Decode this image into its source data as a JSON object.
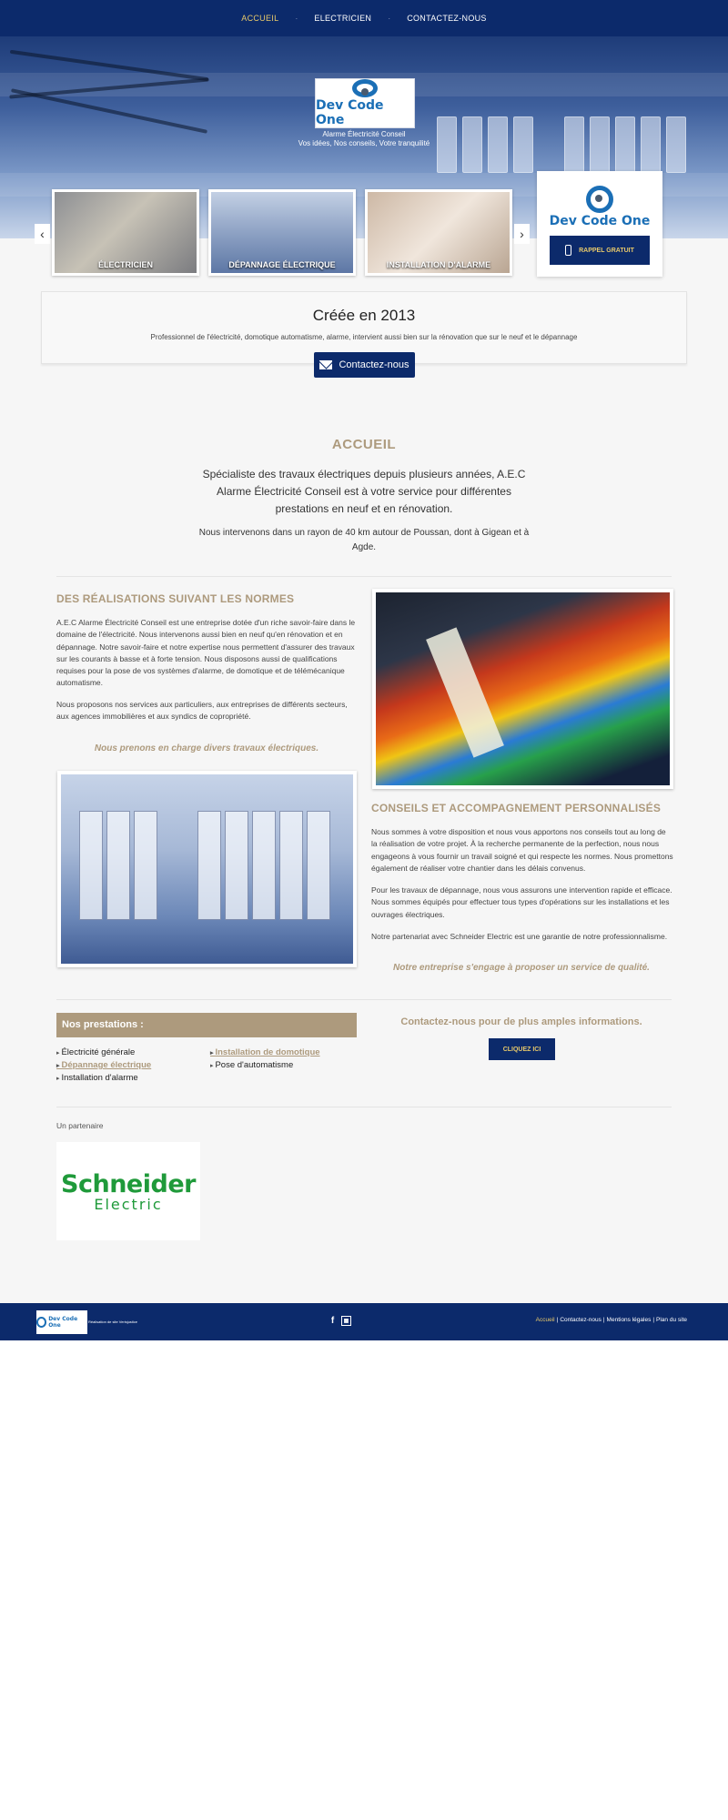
{
  "nav": {
    "items": [
      {
        "label": "ACCUEIL",
        "active": true
      },
      {
        "label": "ELECTRICIEN",
        "active": false
      },
      {
        "label": "CONTACTEZ-NOUS",
        "active": false
      }
    ],
    "separator": "·"
  },
  "hero": {
    "logo_text": "Dev Code One",
    "subtitle_1": "Alarme Électricité Conseil",
    "subtitle_2": "Vos idées, Nos conseils, Votre tranquilité",
    "thumbs": [
      {
        "label": "ÉLECTRICIEN"
      },
      {
        "label": "DÉPANNAGE ÉLECTRIQUE"
      },
      {
        "label": "INSTALLATION D'ALARME"
      }
    ],
    "prev_arrow": "‹",
    "next_arrow": "›"
  },
  "card": {
    "logo_text": "Dev Code One",
    "button_label": "RAPPEL GRATUIT"
  },
  "created": {
    "title": "Créée en 2013",
    "text": "Professionnel de l'électricité, domotique automatisme, alarme, intervient aussi bien sur la rénovation que sur le neuf et le dépannage",
    "button_label": "Contactez-nous"
  },
  "accueil": {
    "title": "ACCUEIL",
    "lead": "Spécialiste des travaux électriques depuis plusieurs années, A.E.C Alarme Électricité Conseil est à votre service pour différentes prestations en neuf et en rénovation.",
    "zone": "Nous intervenons dans un rayon de 40 km autour de Poussan, dont à Gigean et à Agde."
  },
  "realisations": {
    "title": "DES RÉALISATIONS SUIVANT LES NORMES",
    "p1": "A.E.C Alarme Électricité Conseil est une entreprise dotée d'un riche savoir-faire dans le domaine de l'électricité. Nous intervenons aussi bien en neuf qu'en rénovation et en dépannage. Notre savoir-faire et notre expertise nous permettent d'assurer des travaux sur les courants à basse et à forte tension. Nous disposons aussi de qualifications requises pour la pose de vos systèmes d'alarme, de domotique et de télémécanique automatisme.",
    "p2": "Nous proposons nos services aux particuliers, aux entreprises de différents secteurs, aux agences immobilières et aux syndics de copropriété.",
    "quote": "Nous prenons en charge divers travaux électriques."
  },
  "conseils": {
    "title": "CONSEILS ET ACCOMPAGNEMENT PERSONNALISÉS",
    "p1": "Nous sommes à votre disposition et nous vous apportons nos conseils tout au long de la réalisation de votre projet. À la recherche permanente de la perfection, nous nous engageons à vous fournir un travail soigné et qui respecte les normes. Nous promettons également de réaliser votre chantier dans les délais convenus.",
    "p2": "Pour les travaux de dépannage, nous vous assurons une intervention rapide et efficace. Nous sommes équipés pour effectuer tous types d'opérations sur les installations et les ouvrages électriques.",
    "p3": "Notre partenariat avec Schneider Electric est une garantie de notre professionnalisme.",
    "quote": "Notre entreprise s'engage à proposer un service de qualité."
  },
  "prestations": {
    "title": "Nos prestations :",
    "col1": [
      {
        "label": "Électricité générale",
        "link": false
      },
      {
        "label": "Dépannage électrique",
        "link": true
      },
      {
        "label": "Installation d'alarme",
        "link": false
      }
    ],
    "col2": [
      {
        "label": "Installation de domotique",
        "link": true
      },
      {
        "label": "Pose d'automatisme",
        "link": false
      }
    ]
  },
  "contact_cta": {
    "text": "Contactez-nous pour de plus amples informations.",
    "button_label": "CLIQUEZ ICI"
  },
  "partner": {
    "label": "Un partenaire",
    "logo_line1": "Schneider",
    "logo_line2": "Electric"
  },
  "footer": {
    "logo_text": "Dev Code One",
    "realisation": "Réalisation de site Verisjustice",
    "social": [
      "facebook-icon",
      "pagesjaunes-icon"
    ],
    "links": [
      {
        "label": "Accueil",
        "active": true
      },
      {
        "label": "Contactez-nous",
        "active": false
      },
      {
        "label": "Mentions légales",
        "active": false
      },
      {
        "label": "Plan du site",
        "active": false
      }
    ]
  },
  "colors": {
    "navy": "#0c2a6b",
    "gold": "#ad9a7d",
    "accent_yellow": "#e8c96a",
    "schneider_green": "#1f9a3a"
  }
}
